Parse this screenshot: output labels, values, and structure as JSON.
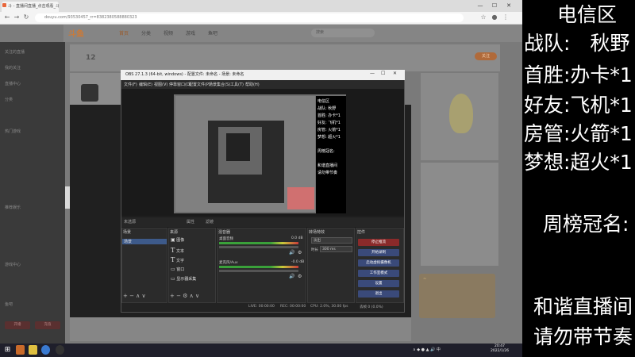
{
  "browser": {
    "tab_title": "斗 - 直播间直播_点击观看_斗鱼",
    "url": "douyu.com/93530457_rr=8382380588880323",
    "window_controls": [
      "—",
      "☐",
      "✕"
    ]
  },
  "site": {
    "logo": "斗鱼",
    "nav": [
      "首页",
      "分类",
      "视频",
      "游戏",
      "鱼吧"
    ],
    "search_placeholder": "搜索",
    "follow_btn": "关注",
    "room_level": "12"
  },
  "sidebar": {
    "items": [
      "关注的直播",
      "我的关注",
      "直播中心",
      "分类",
      "热门游戏",
      "推荐娱乐",
      "游戏中心",
      "鱼吧"
    ],
    "red_buttons": [
      "开播",
      "充值"
    ]
  },
  "obs": {
    "title": "OBS 27.1.3 (64-bit, windows) - 配置文件: 未命名 - 场景: 未命名",
    "menu": [
      "文件(F)",
      "编辑(E)",
      "视图(V)",
      "停靠窗口(D)",
      "配置文件(P)",
      "场景集合(S)",
      "工具(T)",
      "帮助(H)"
    ],
    "scenebar_left": "未选源",
    "scenebar_props": "属性",
    "scenebar_filters": "滤镜",
    "docks": {
      "scenes_title": "场景",
      "scenes": [
        "场景"
      ],
      "sources_title": "来源",
      "sources": [
        "图像",
        "文本",
        "文字",
        "窗口",
        "显示器采集"
      ],
      "mixer_title": "混音器",
      "mixer": [
        {
          "name": "桌面音频",
          "db": "0.0 dB"
        },
        {
          "name": "麦克风/Aux",
          "db": "-0.0 dB"
        }
      ],
      "transitions_title": "转场特效",
      "transition_type": "淡出",
      "duration_label": "时长",
      "duration_value": "300 ms",
      "controls_title": "控件",
      "controls": [
        "停止推流",
        "开始录制",
        "启动虚拟摄像机",
        "工作室模式",
        "设置",
        "退出"
      ]
    },
    "status": {
      "live": "LIVE: 00:00:00",
      "rec": "REC: 00:00:00",
      "cpu": "CPU: 2.0%, 30.00 fps",
      "dropped": "丢帧 0 (0.0%)"
    }
  },
  "mini_overlay": {
    "lines": [
      "电信区",
      "战队: 秋野",
      "首胜: 办卡*1",
      "好友: 飞机*1",
      "房管: 火箭*1",
      "梦想: 超火*1",
      "",
      "周榜冠名:",
      "",
      "和谐直播间",
      "请勿带节奏"
    ]
  },
  "overlay": {
    "title": "电信区",
    "team": "战队:　秋野",
    "first_win": "首胜:办卡*1",
    "friend": "好友:飞机*1",
    "admin": "房管:火箭*1",
    "dream": "梦想:超火*1",
    "weekly": "周榜冠名:",
    "rule1": "和谐直播间",
    "rule2": "请勿带节奏"
  },
  "taskbar": {
    "time": "20:47",
    "date": "2022/1/26"
  }
}
